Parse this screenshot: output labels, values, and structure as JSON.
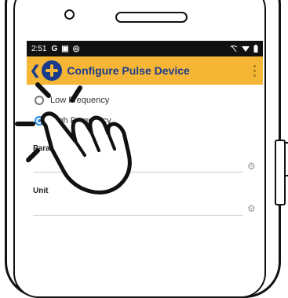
{
  "status_bar": {
    "time": "2:51",
    "icons_left": [
      "G",
      "▣",
      "◎"
    ],
    "icons_right": [
      "wifi-off-icon",
      "signal-icon",
      "battery-icon"
    ]
  },
  "app_bar": {
    "title": "Configure Pulse Device",
    "back_icon": "chevron-left-icon",
    "logo": "app-logo",
    "menu_icon": "more-vert-icon",
    "color": "#f5b636",
    "text_color": "#1a3b8c"
  },
  "radio_options": [
    {
      "label": "Low Frequency",
      "checked": false
    },
    {
      "label": "High Frequency",
      "checked": true
    }
  ],
  "fields": [
    {
      "label": "Parameter",
      "value": ""
    },
    {
      "label": "Unit",
      "value": ""
    }
  ],
  "overlay": {
    "icon": "tap-hand-icon"
  }
}
